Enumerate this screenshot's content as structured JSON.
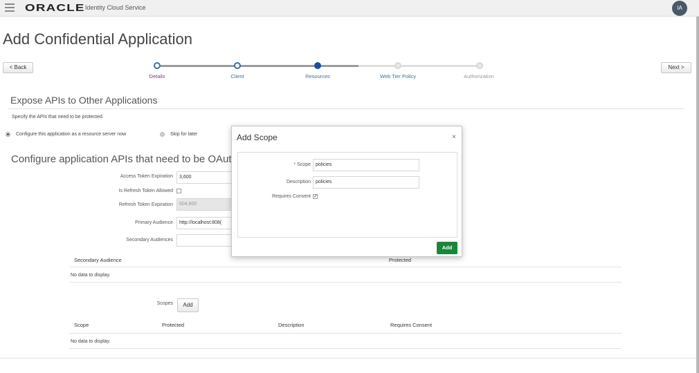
{
  "header": {
    "brand": "ORACLE",
    "service": "Identity Cloud Service",
    "avatar": "IA"
  },
  "page": {
    "title": "Add Confidential Application",
    "back": "< Back",
    "next": "Next >"
  },
  "train": {
    "steps": [
      {
        "label": "Details",
        "state": "visited"
      },
      {
        "label": "Client",
        "state": "visited"
      },
      {
        "label": "Resources",
        "state": "current"
      },
      {
        "label": "Web Tier Policy",
        "state": "future"
      },
      {
        "label": "Authorization",
        "state": "future"
      }
    ]
  },
  "expose": {
    "title": "Expose APIs to Other Applications",
    "desc": "Specify the APIs that need to be protected.",
    "radio_now": "Configure this application as a resource server now",
    "radio_later": "Skip for later"
  },
  "configure": {
    "title": "Configure application APIs that need to be OAuth pr",
    "access_label": "Access Token Expiration",
    "access_value": "3,600",
    "refresh_allowed_label": "Is Refresh Token Allowed",
    "refresh_exp_label": "Refresh Token Expiration",
    "refresh_exp_value": "604,800",
    "primary_label": "Primary Audience",
    "primary_value": "http://localhost:808(",
    "secondary_label": "Secondary Audiences",
    "secondary_value": ""
  },
  "secondary_table": {
    "headers": [
      "Secondary Audience",
      "Protected"
    ],
    "empty": "No data to display."
  },
  "scopes": {
    "label": "Scopes",
    "add": "Add",
    "headers": [
      "Scope",
      "Protected",
      "Description",
      "Requires Consent"
    ],
    "empty": "No data to display."
  },
  "dialog": {
    "title": "Add Scope",
    "close": "×",
    "scope_label": "Scope",
    "scope_value": "policies",
    "desc_label": "Description",
    "desc_value": "policies",
    "consent_label": "Requires Consent",
    "consent_checked": true,
    "add": "Add"
  }
}
